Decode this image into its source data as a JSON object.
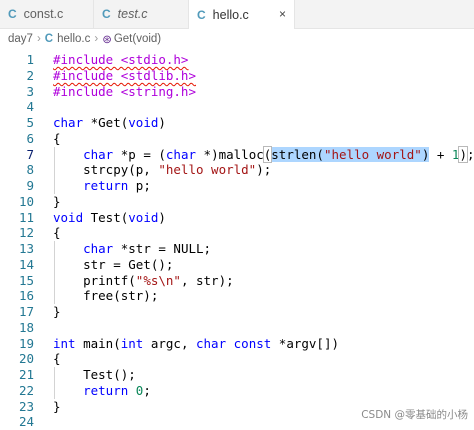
{
  "tabs": [
    {
      "icon": "C",
      "label": "const.c",
      "italic": false,
      "active": false
    },
    {
      "icon": "C",
      "label": "test.c",
      "italic": true,
      "active": false
    },
    {
      "icon": "C",
      "label": "hello.c",
      "italic": false,
      "active": true,
      "close": "×"
    }
  ],
  "breadcrumb": {
    "folder": "day7",
    "file_icon": "C",
    "file": "hello.c",
    "symbol_icon": "⊛",
    "symbol": "Get(void)",
    "separator": "›"
  },
  "lines": [
    {
      "n": "1",
      "tokens": [
        {
          "t": "#include <stdio.h>",
          "c": "pp squig"
        }
      ]
    },
    {
      "n": "2",
      "tokens": [
        {
          "t": "#include <stdlib.h>",
          "c": "pp squig"
        }
      ]
    },
    {
      "n": "3",
      "tokens": [
        {
          "t": "#include <string.h>",
          "c": "pp"
        }
      ]
    },
    {
      "n": "4",
      "tokens": []
    },
    {
      "n": "5",
      "tokens": [
        {
          "t": "char",
          "c": "kw"
        },
        {
          "t": " *Get(",
          "c": ""
        },
        {
          "t": "void",
          "c": "kw"
        },
        {
          "t": ")",
          "c": ""
        }
      ]
    },
    {
      "n": "6",
      "tokens": [
        {
          "t": "{",
          "c": ""
        }
      ]
    },
    {
      "n": "7",
      "current": true,
      "tokens": [
        {
          "t": "    ",
          "c": ""
        },
        {
          "t": "char",
          "c": "kw"
        },
        {
          "t": " *p = (",
          "c": ""
        },
        {
          "t": "char",
          "c": "kw"
        },
        {
          "t": " *)malloc",
          "c": ""
        },
        {
          "t": "(",
          "c": "paren-match"
        },
        {
          "t": "strlen(",
          "c": "sel"
        },
        {
          "t": "\"hello world\"",
          "c": "str sel"
        },
        {
          "t": ")",
          "c": "sel"
        },
        {
          "t": " + ",
          "c": ""
        },
        {
          "t": "1",
          "c": "num"
        },
        {
          "t": ")",
          "c": "paren-match"
        },
        {
          "t": ";",
          "c": ""
        }
      ]
    },
    {
      "n": "8",
      "tokens": [
        {
          "t": "    strcpy(p, ",
          "c": ""
        },
        {
          "t": "\"hello world\"",
          "c": "str"
        },
        {
          "t": ");",
          "c": ""
        }
      ]
    },
    {
      "n": "9",
      "tokens": [
        {
          "t": "    ",
          "c": ""
        },
        {
          "t": "return",
          "c": "kw"
        },
        {
          "t": " p;",
          "c": ""
        }
      ]
    },
    {
      "n": "10",
      "tokens": [
        {
          "t": "}",
          "c": ""
        }
      ]
    },
    {
      "n": "11",
      "tokens": [
        {
          "t": "void",
          "c": "kw"
        },
        {
          "t": " Test(",
          "c": ""
        },
        {
          "t": "void",
          "c": "kw"
        },
        {
          "t": ")",
          "c": ""
        }
      ]
    },
    {
      "n": "12",
      "tokens": [
        {
          "t": "{",
          "c": ""
        }
      ]
    },
    {
      "n": "13",
      "tokens": [
        {
          "t": "    ",
          "c": ""
        },
        {
          "t": "char",
          "c": "kw"
        },
        {
          "t": " *str = NULL;",
          "c": ""
        }
      ]
    },
    {
      "n": "14",
      "tokens": [
        {
          "t": "    str = Get();",
          "c": ""
        }
      ]
    },
    {
      "n": "15",
      "tokens": [
        {
          "t": "    printf(",
          "c": ""
        },
        {
          "t": "\"%s\\n\"",
          "c": "str"
        },
        {
          "t": ", str);",
          "c": ""
        }
      ]
    },
    {
      "n": "16",
      "tokens": [
        {
          "t": "    free(str);",
          "c": ""
        }
      ]
    },
    {
      "n": "17",
      "tokens": [
        {
          "t": "}",
          "c": ""
        }
      ]
    },
    {
      "n": "18",
      "tokens": []
    },
    {
      "n": "19",
      "tokens": [
        {
          "t": "int",
          "c": "kw"
        },
        {
          "t": " main(",
          "c": ""
        },
        {
          "t": "int",
          "c": "kw"
        },
        {
          "t": " argc, ",
          "c": ""
        },
        {
          "t": "char",
          "c": "kw"
        },
        {
          "t": " ",
          "c": ""
        },
        {
          "t": "const",
          "c": "kw"
        },
        {
          "t": " *argv[])",
          "c": ""
        }
      ]
    },
    {
      "n": "20",
      "tokens": [
        {
          "t": "{",
          "c": ""
        }
      ]
    },
    {
      "n": "21",
      "tokens": [
        {
          "t": "    Test();",
          "c": ""
        }
      ]
    },
    {
      "n": "22",
      "tokens": [
        {
          "t": "    ",
          "c": ""
        },
        {
          "t": "return",
          "c": "kw"
        },
        {
          "t": " ",
          "c": ""
        },
        {
          "t": "0",
          "c": "num"
        },
        {
          "t": ";",
          "c": ""
        }
      ]
    },
    {
      "n": "23",
      "tokens": [
        {
          "t": "}",
          "c": ""
        }
      ]
    },
    {
      "n": "24",
      "tokens": []
    }
  ],
  "watermark": "CSDN @零基础的小杨"
}
